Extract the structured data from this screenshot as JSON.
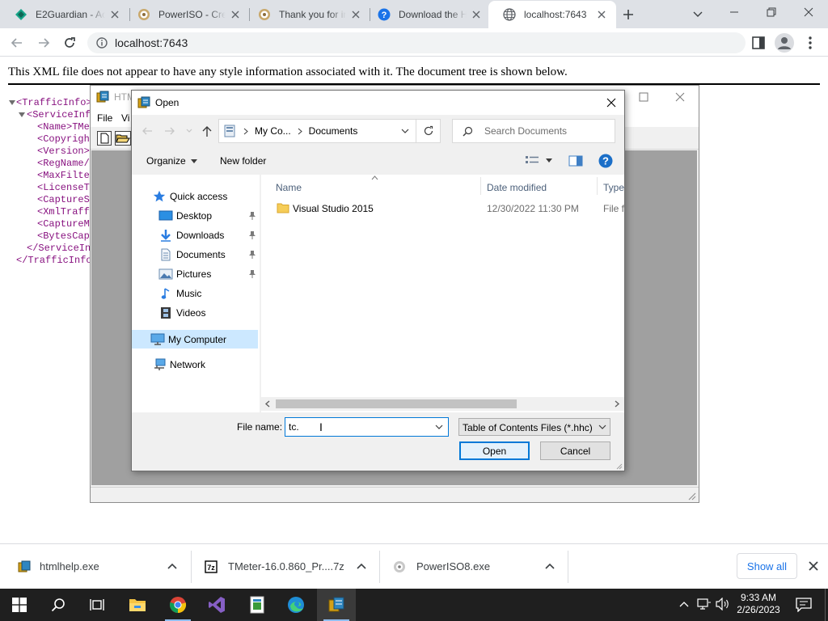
{
  "browser": {
    "tabs": [
      {
        "label": "E2Guardian - Ac",
        "icon": "e2guardian-favicon"
      },
      {
        "label": "PowerISO - Crea",
        "icon": "poweriso-favicon"
      },
      {
        "label": "Thank you for in",
        "icon": "poweriso-favicon"
      },
      {
        "label": "Download the H",
        "icon": "question-favicon"
      },
      {
        "label": "localhost:7643",
        "icon": "globe-favicon",
        "active": true
      }
    ],
    "url": "localhost:7643"
  },
  "xml_page": {
    "notice": "This XML file does not appear to have any style information associated with it. The document tree is shown below.",
    "lines": [
      "<TrafficInfo>",
      "<ServiceInf",
      "<Name>TMet",
      "<Copyrigh",
      "<Version>",
      "<RegName/",
      "<MaxFilte",
      "<LicenseT",
      "<CaptureS",
      "<XmlTraff",
      "<CaptureMe",
      "<BytesCapt",
      "</ServiceIn",
      "</TrafficInfo"
    ]
  },
  "help_window": {
    "title": "HTM",
    "menu": [
      "File",
      "Vi"
    ]
  },
  "open_dialog": {
    "title": "Open",
    "breadcrumb": [
      "My Co...",
      "Documents"
    ],
    "search_placeholder": "Search Documents",
    "organize_label": "Organize",
    "new_folder_label": "New folder",
    "nav_items": [
      {
        "label": "Quick access",
        "icon": "star-icon"
      },
      {
        "label": "Desktop",
        "icon": "desktop-icon",
        "pinned": true
      },
      {
        "label": "Downloads",
        "icon": "download-arrow-icon",
        "pinned": true
      },
      {
        "label": "Documents",
        "icon": "document-icon",
        "pinned": true
      },
      {
        "label": "Pictures",
        "icon": "picture-icon",
        "pinned": true
      },
      {
        "label": "Music",
        "icon": "music-note-icon"
      },
      {
        "label": "Videos",
        "icon": "film-icon"
      },
      {
        "label": "My Computer",
        "icon": "computer-icon",
        "selected": true
      },
      {
        "label": "Network",
        "icon": "network-icon"
      }
    ],
    "columns": [
      "Name",
      "Date modified",
      "Type"
    ],
    "files": [
      {
        "name": "Visual Studio 2015",
        "modified": "12/30/2022 11:30 PM",
        "type": "File fo"
      }
    ],
    "file_name_label": "File name:",
    "file_name_value": "tc.",
    "file_type_value": "Table of Contents Files (*.hhc)",
    "open_label": "Open",
    "cancel_label": "Cancel"
  },
  "downloads": {
    "items": [
      {
        "name": "htmlhelp.exe"
      },
      {
        "name": "TMeter-16.0.860_Pr....7z"
      },
      {
        "name": "PowerISO8.exe"
      }
    ],
    "show_all_label": "Show all"
  },
  "taskbar": {
    "time": "9:33 AM",
    "date": "2/26/2023"
  },
  "colors": {
    "tabstrip": "#dee1e6",
    "accent_blue": "#0078d7",
    "taskbar": "#1f1f1f",
    "xml_tag": "#881280"
  }
}
